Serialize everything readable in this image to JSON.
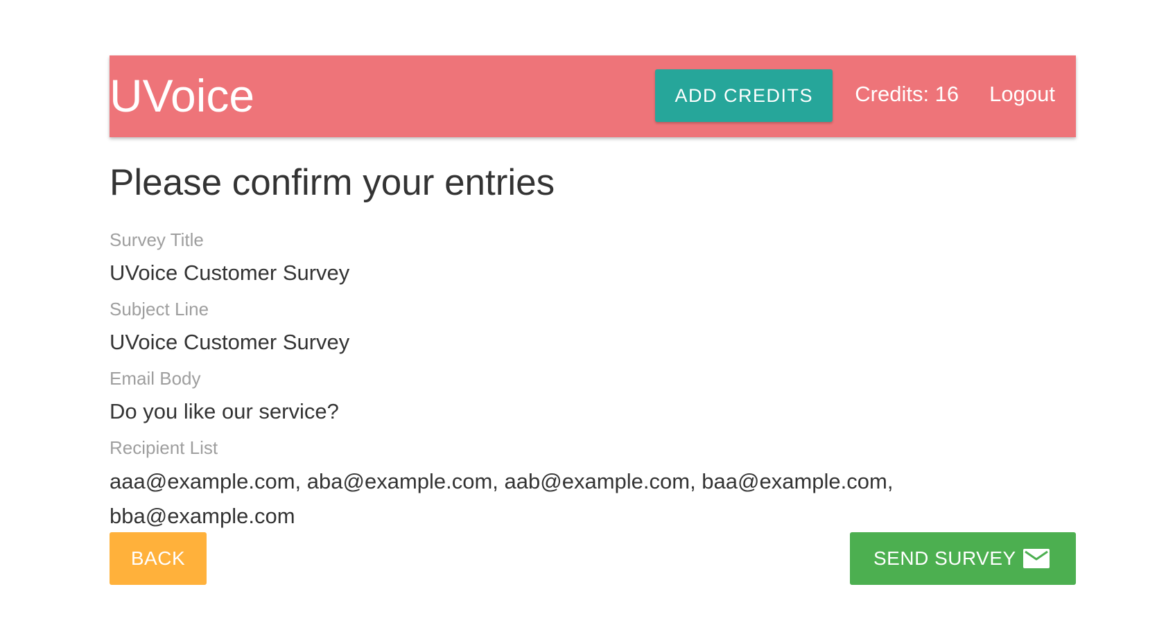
{
  "colors": {
    "brand": "#ee7479",
    "teal": "#26a69a",
    "amber": "#ffb13b",
    "green": "#4caf50"
  },
  "header": {
    "brand": "UVoice",
    "add_credits_label": "ADD CREDITS",
    "credits_text": "Credits: 16",
    "logout_label": "Logout"
  },
  "page": {
    "title": "Please confirm your entries"
  },
  "fields": [
    {
      "label": "Survey Title",
      "value": "UVoice Customer Survey"
    },
    {
      "label": "Subject Line",
      "value": "UVoice Customer Survey"
    },
    {
      "label": "Email Body",
      "value": "Do you like our service?"
    },
    {
      "label": "Recipient List",
      "value": "aaa@example.com, aba@example.com, aab@example.com, baa@example.com, bba@example.com"
    }
  ],
  "actions": {
    "back_label": "BACK",
    "send_label": "SEND SURVEY",
    "send_icon": "email-icon"
  }
}
